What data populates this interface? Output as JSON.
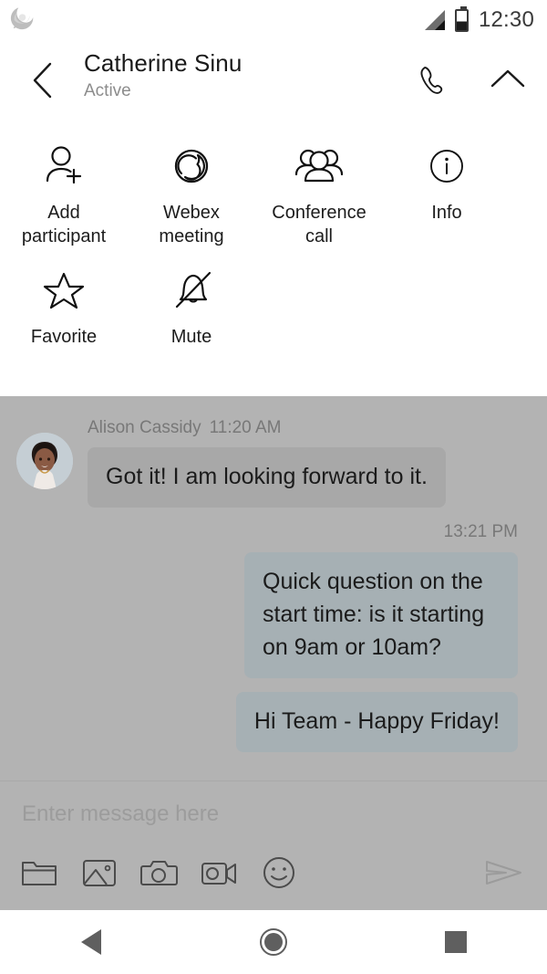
{
  "status_bar": {
    "app_icon": "webex-teams-notification-icon",
    "signal_icon": "cellular-signal-icon",
    "battery_icon": "battery-half-icon",
    "clock": "12:30"
  },
  "header": {
    "back_icon": "chevron-left-icon",
    "contact_name": "Catherine Sinu",
    "presence": "Active",
    "call_icon": "phone-icon",
    "collapse_icon": "chevron-up-icon"
  },
  "action_panel": {
    "rows": [
      [
        {
          "icon": "add-participant-icon",
          "label": "Add\nparticipant",
          "line1": "Add",
          "line2": "participant"
        },
        {
          "icon": "webex-meeting-icon",
          "label": "Webex\nmeeting",
          "line1": "Webex",
          "line2": "meeting"
        },
        {
          "icon": "conference-call-icon",
          "label": "Conference\ncall",
          "line1": "Conference",
          "line2": "call"
        },
        {
          "icon": "info-icon",
          "label": "Info",
          "line1": "Info",
          "line2": ""
        }
      ],
      [
        {
          "icon": "star-icon",
          "label": "Favorite",
          "line1": "Favorite",
          "line2": ""
        },
        {
          "icon": "bell-mute-icon",
          "label": "Mute",
          "line1": "Mute",
          "line2": ""
        }
      ]
    ]
  },
  "chat": {
    "incoming": {
      "avatar": "avatar-alison-cassidy",
      "sender": "Alison Cassidy",
      "time": "11:20 AM",
      "text": "Got it! I am looking forward to it."
    },
    "outgoing_time": "13:21 PM",
    "outgoing": [
      {
        "text": "Quick question on the start time: is it starting on 9am or 10am?"
      },
      {
        "text": "Hi Team - Happy Friday!"
      }
    ]
  },
  "composer": {
    "placeholder": "Enter message here",
    "value": "",
    "tools": [
      {
        "icon": "folder-icon",
        "name": "attach-file-button"
      },
      {
        "icon": "image-icon",
        "name": "attach-image-button"
      },
      {
        "icon": "camera-icon",
        "name": "camera-button"
      },
      {
        "icon": "video-camera-icon",
        "name": "video-button"
      },
      {
        "icon": "smiley-icon",
        "name": "emoji-button"
      }
    ],
    "send_icon": "send-icon"
  },
  "navbar": {
    "back_icon": "android-back-icon",
    "home_icon": "android-home-icon",
    "recents_icon": "android-recents-icon"
  },
  "colors": {
    "panel_bg": "#ffffff",
    "chat_bg": "#b3b3b3",
    "incoming_bubble": "#a8a8a8",
    "outgoing_bubble": "#a6b0b4",
    "text_primary": "#1b1b1b",
    "text_muted": "#787878"
  }
}
